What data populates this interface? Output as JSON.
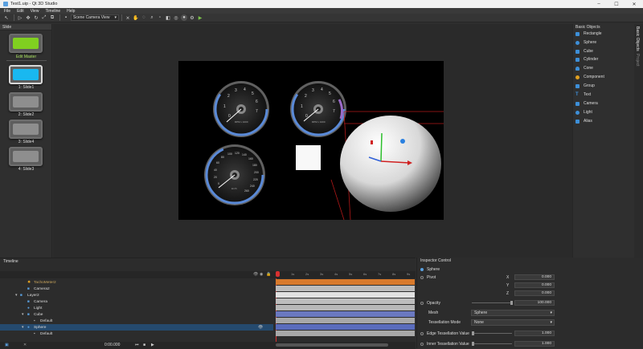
{
  "window": {
    "title": "Test1.uip - Qt 3D Studio",
    "minimize": "–",
    "maximize": "☐",
    "close": "✕"
  },
  "menu": [
    "File",
    "Edit",
    "View",
    "Timeline",
    "Help"
  ],
  "toolbar": {
    "camera_view": "Scene Camera View"
  },
  "slide_panel": {
    "title": "Slide",
    "master_label": "Edit Master",
    "slides": [
      "1: Slide1",
      "2: Slide2",
      "3: Slide4",
      "4: Slide3"
    ]
  },
  "basic_objects": {
    "title": "Basic Objects",
    "items": [
      "Rectangle",
      "Sphere",
      "Cube",
      "Cylinder",
      "Cone",
      "Component",
      "Group",
      "Text",
      "Camera",
      "Light",
      "Alias"
    ]
  },
  "side_tabs": [
    "Basic Objects",
    "Project"
  ],
  "gauges": {
    "left_numbers": [
      "0",
      "1",
      "2",
      "3",
      "4",
      "5",
      "6",
      "7",
      "8"
    ],
    "left_caption": "RPM x 1000",
    "right_numbers": [
      "0",
      "1",
      "2",
      "3",
      "4",
      "5",
      "6",
      "7",
      "8"
    ],
    "right_caption": "RPM x 1000",
    "speed_numbers": [
      "0",
      "20",
      "40",
      "60",
      "80",
      "100",
      "120",
      "140",
      "160",
      "180",
      "200",
      "220",
      "240",
      "260"
    ],
    "speed_caption": "km/h"
  },
  "timeline": {
    "title": "Timeline",
    "rows": [
      {
        "label": "TachoMeter2"
      },
      {
        "label": "Camera2"
      },
      {
        "label": "Layer2"
      },
      {
        "label": "Camera"
      },
      {
        "label": "Light"
      },
      {
        "label": "Cube"
      },
      {
        "label": "Default"
      },
      {
        "label": "Sphere"
      },
      {
        "label": "Default"
      }
    ],
    "ruler": [
      "0s",
      "1s",
      "2s",
      "3s",
      "4s",
      "5s",
      "6s",
      "7s",
      "8s",
      "9s"
    ],
    "time": "0:00.000"
  },
  "inspector": {
    "title": "Inspector Control",
    "object": "Sphere",
    "pivot_label": "Pivot",
    "x_label": "X",
    "x_value": "0.000",
    "y_label": "Y",
    "y_value": "0.000",
    "z_label": "Z",
    "z_value": "0.000",
    "opacity_label": "Opacity",
    "opacity_value": "100.000",
    "mesh_label": "Mesh",
    "mesh_value": "Sphere",
    "tess_mode_label": "Tessellation Mode",
    "tess_mode_value": "None",
    "edge_tess_label": "Edge Tessellation Value",
    "edge_tess_value": "1.000",
    "inner_tess_label": "Inner Tessellation Value",
    "inner_tess_value": "1.000"
  },
  "colors": {
    "accent": "#5aa0e0",
    "selection": "#254a6e",
    "tracks_orange": "#d87a2c",
    "master_green": "#80d020",
    "slide_blue": "#19b8f0"
  }
}
